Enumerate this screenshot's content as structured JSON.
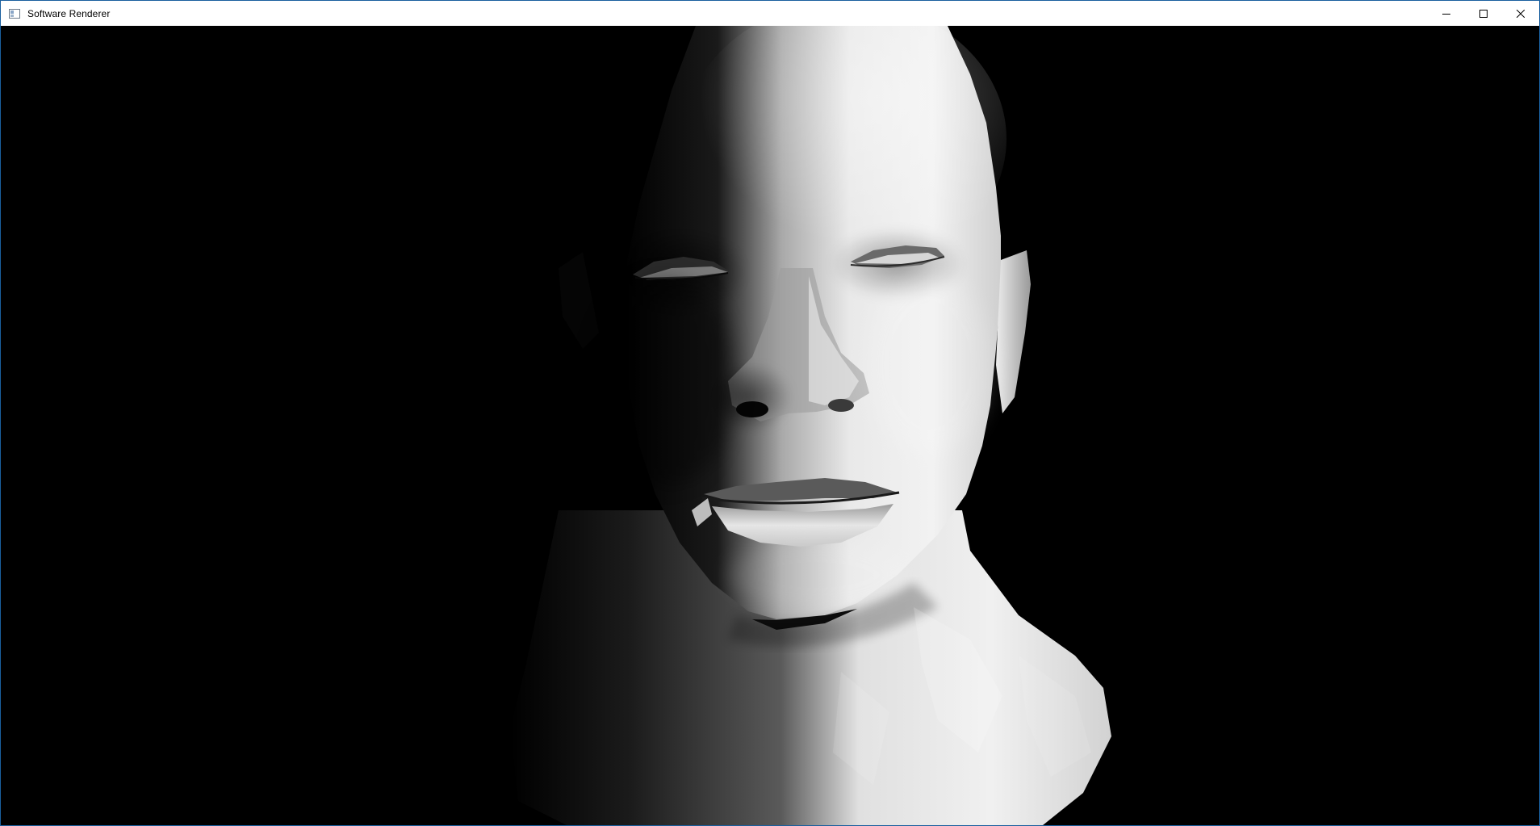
{
  "window": {
    "title": "Software Renderer",
    "app_icon": "window-app-icon",
    "controls": [
      {
        "name": "minimize-button",
        "icon": "minimize-icon"
      },
      {
        "name": "maximize-button",
        "icon": "maximize-icon"
      },
      {
        "name": "close-button",
        "icon": "close-icon"
      }
    ]
  },
  "viewport": {
    "content": "rendered-3d-head-model",
    "background_color": "#000000",
    "shading": "grayscale-gouraud"
  }
}
